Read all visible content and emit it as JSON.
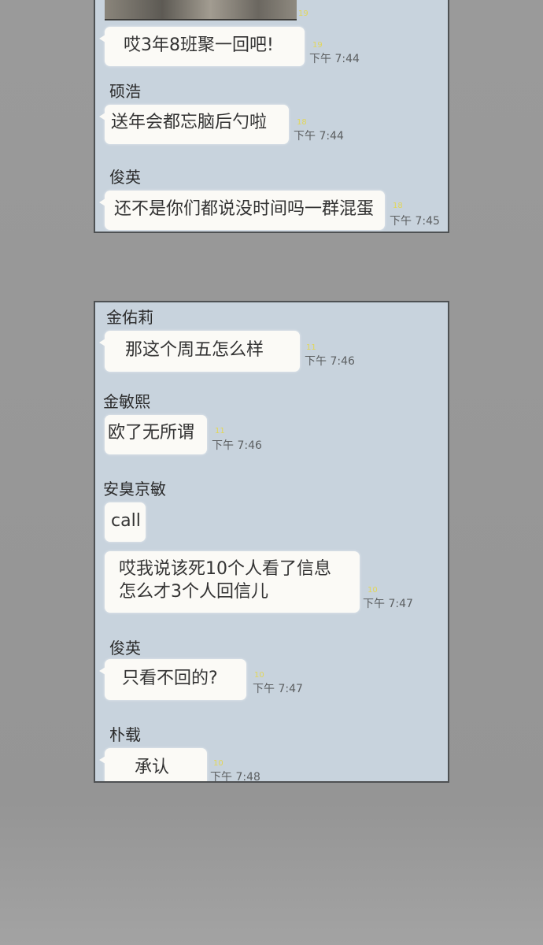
{
  "panel_top": {
    "messages": [
      {
        "sender": "",
        "text": "哎3年8班聚一回吧!",
        "unread": "19",
        "time": "下午 7:44"
      },
      {
        "sender": "硕浩",
        "text": "送年会都忘脑后勺啦",
        "unread": "18",
        "time": "下午 7:44"
      },
      {
        "sender": "俊英",
        "text": "还不是你们都说没时间吗一群混蛋",
        "unread": "18",
        "time": "下午 7:45"
      }
    ]
  },
  "panel_bottom": {
    "messages": [
      {
        "sender": "金佑莉",
        "text": "那这个周五怎么样",
        "unread": "11",
        "time": "下午 7:46"
      },
      {
        "sender": "金敏熙",
        "text": "欧了无所谓",
        "unread": "11",
        "time": "下午 7:46"
      },
      {
        "sender": "安臭京敏",
        "text": "call",
        "unread": "",
        "time": ""
      },
      {
        "sender": "",
        "text": [
          "哎我说该死10个人看了信息",
          "怎么才3个人回信儿"
        ],
        "unread": "10",
        "time": "下午 7:47"
      },
      {
        "sender": "俊英",
        "text": "只看不回的?",
        "unread": "10",
        "time": "下午 7:47"
      },
      {
        "sender": "朴载",
        "text": "承认",
        "unread": "10",
        "time": "下午 7:48"
      }
    ]
  }
}
